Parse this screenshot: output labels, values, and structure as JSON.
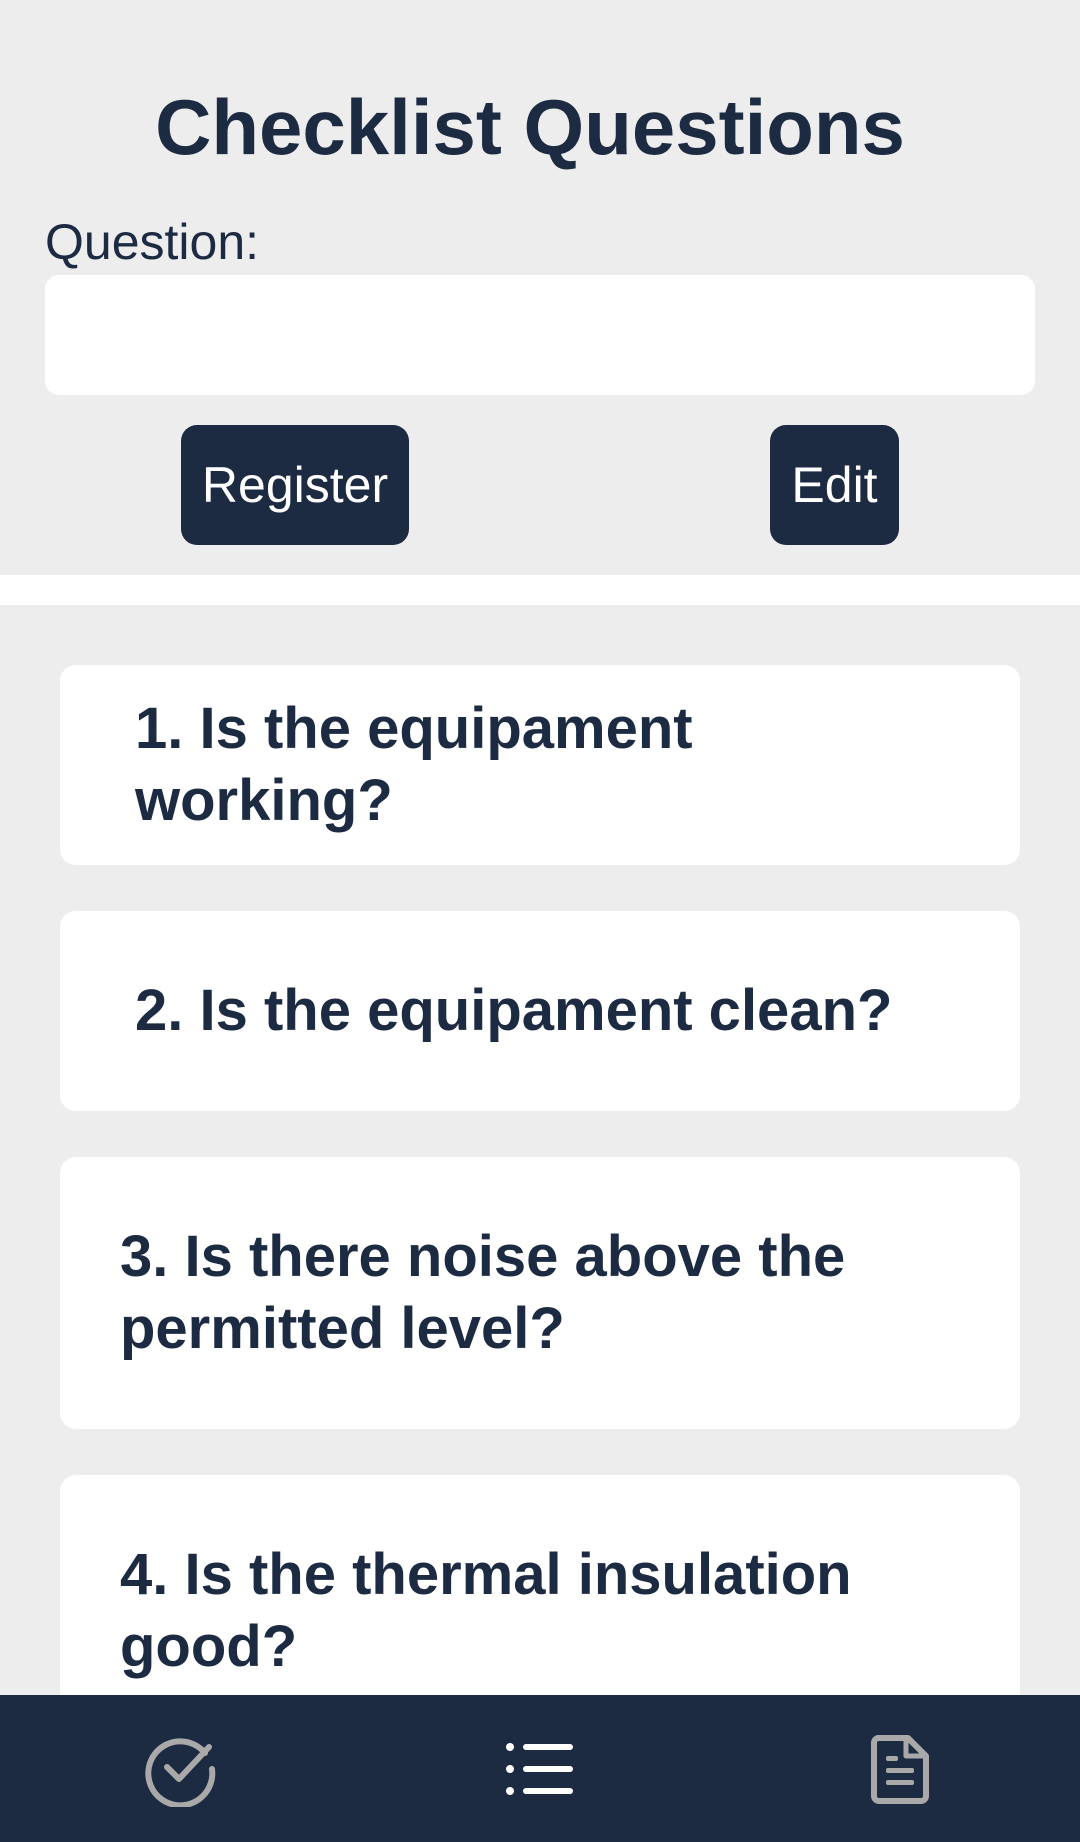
{
  "header": {
    "title": "Checklist Questions"
  },
  "form": {
    "question_label": "Question:",
    "question_value": "",
    "register_label": "Register",
    "edit_label": "Edit"
  },
  "questions": [
    {
      "text": "1. Is the equipament working?"
    },
    {
      "text": "2. Is the equipament clean?"
    },
    {
      "text": "3. Is there noise above the permitted level?"
    },
    {
      "text": "4. Is the thermal insulation good?"
    }
  ],
  "bottom_nav": {
    "items": [
      {
        "icon": "check-circle-icon",
        "color": "#a9a9a9"
      },
      {
        "icon": "list-icon",
        "color": "#ffffff"
      },
      {
        "icon": "document-icon",
        "color": "#a9a9a9"
      }
    ]
  },
  "colors": {
    "primary": "#1c2a42",
    "background": "#ededed",
    "card": "#ffffff",
    "inactive_icon": "#a9a9a9"
  }
}
